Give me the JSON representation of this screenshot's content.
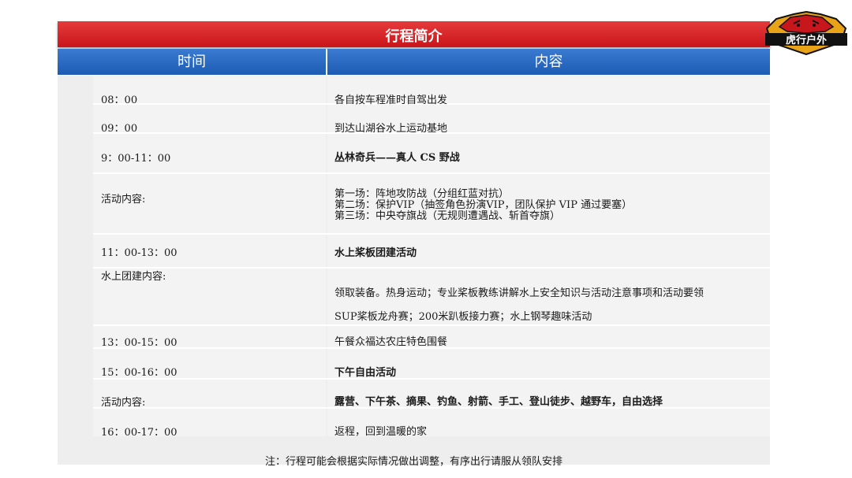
{
  "header": {
    "title": "行程简介"
  },
  "logo": {
    "text": "虎行户外",
    "colors": {
      "red": "#c8161d",
      "gold": "#e8a317",
      "black": "#111111"
    }
  },
  "columns": {
    "time": "时间",
    "content": "内容"
  },
  "rows": [
    {
      "time": "08：00",
      "content": "各自按车程准时自驾出发"
    },
    {
      "time": "09：00",
      "content": "到达山湖谷水上运动基地"
    },
    {
      "time": "9：00-11：00",
      "content": "丛林奇兵——真人 CS 野战"
    },
    {
      "time": "活动内容:",
      "lines": [
        "第一场：阵地攻防战（分组红蓝对抗）",
        "第二场：保护VIP（抽签角色扮演VIP，团队保护 VIP 通过要塞）",
        "第三场：中央夺旗战（无规则遭遇战、斩首夺旗）"
      ]
    },
    {
      "time": "11：00-13：00",
      "content": "水上桨板团建活动"
    },
    {
      "time": "水上团建内容:",
      "lines": [
        "领取装备。热身运动；专业桨板教练讲解水上安全知识与活动注意事项和活动要领",
        "SUP桨板龙舟赛；200米趴板接力赛；水上钢琴趣味活动"
      ]
    },
    {
      "time": "13：00-15：00",
      "content": "午餐众福达农庄特色围餐"
    },
    {
      "time": "15：00-16：00",
      "content": "下午自由活动"
    },
    {
      "time": "活动内容:",
      "content": "露营、下午茶、摘果、钓鱼、射箭、手工、登山徒步、越野车，自由选择"
    },
    {
      "time": "16：00-17：00",
      "content": "返程，回到温暖的家"
    }
  ],
  "note": "注：行程可能会根据实际情况做出调整，有序出行请服从领队安排",
  "colors": {
    "title_red": "#d42026",
    "header_blue": "#2a6cc4",
    "table_bg": "#eeeeee"
  }
}
